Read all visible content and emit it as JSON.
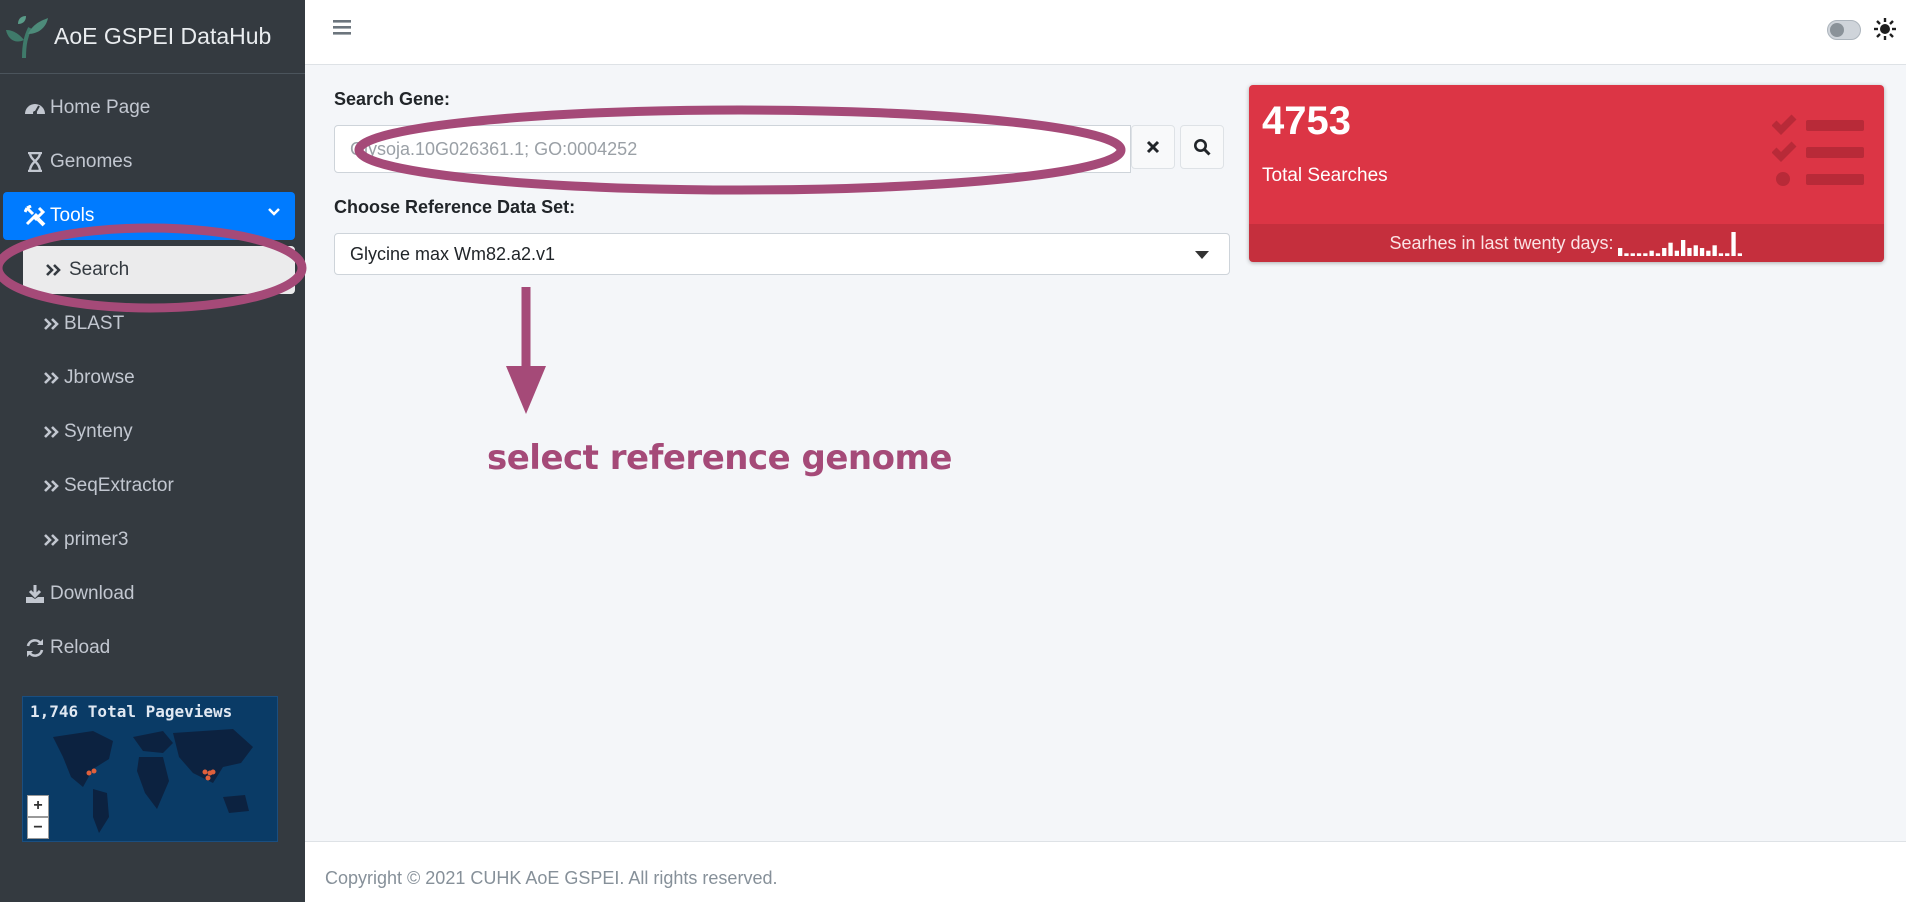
{
  "brand": {
    "name": "AoE GSPEI DataHub"
  },
  "sidebar": {
    "items": [
      {
        "label": "Home Page",
        "icon": "dashboard-gauge-icon"
      },
      {
        "label": "Genomes",
        "icon": "hourglass-icon"
      },
      {
        "label": "Tools",
        "icon": "tools-icon"
      },
      {
        "label": "Search",
        "icon": "double-chevron-right-icon"
      },
      {
        "label": "BLAST",
        "icon": "double-chevron-right-icon"
      },
      {
        "label": "Jbrowse",
        "icon": "double-chevron-right-icon"
      },
      {
        "label": "Synteny",
        "icon": "double-chevron-right-icon"
      },
      {
        "label": "SeqExtractor",
        "icon": "double-chevron-right-icon"
      },
      {
        "label": "primer3",
        "icon": "double-chevron-right-icon"
      },
      {
        "label": "Download",
        "icon": "download-icon"
      },
      {
        "label": "Reload",
        "icon": "refresh-icon"
      }
    ],
    "map_widget": {
      "title": "1,746 Total Pageviews",
      "zoom_in": "+",
      "zoom_out": "−"
    }
  },
  "search": {
    "label": "Search Gene:",
    "placeholder": "Glysoja.10G026361.1; GO:0004252"
  },
  "reference": {
    "label": "Choose Reference Data Set:",
    "selected": "Glycine max Wm82.a2.v1"
  },
  "stats": {
    "count": "4753",
    "label": "Total Searches",
    "footer": "Searhes in last twenty days:",
    "sparkline_values": [
      3,
      1,
      1,
      1,
      1,
      2,
      1,
      3,
      5,
      2,
      6,
      3,
      4,
      3,
      2,
      4,
      1,
      1,
      9,
      1
    ]
  },
  "annotation": {
    "text": "select reference genome"
  },
  "footer": {
    "copyright": "Copyright © 2021 CUHK AoE GSPEI. All rights reserved."
  },
  "colors": {
    "sidebar": "#343a40",
    "primary": "#007bff",
    "danger": "#dc3545",
    "annotation": "#a54a78"
  }
}
